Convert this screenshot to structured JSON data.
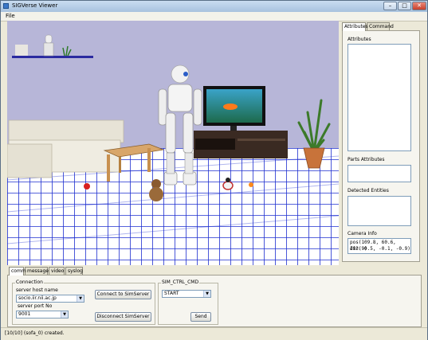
{
  "window": {
    "title": "SIGVerse Viewer",
    "buttons": {
      "minimize": "–",
      "maximize": "□",
      "close": "✕"
    }
  },
  "menu": {
    "file": "File"
  },
  "side_panel": {
    "tabs": [
      {
        "label": "Attributes"
      },
      {
        "label": "Command"
      }
    ],
    "attributes_label": "Attributes",
    "parts_attributes_label": "Parts Attributes",
    "detected_entities_label": "Detected Entities",
    "camera_info_label": "Camera Info",
    "camera_pos": "pos(109.8, 60.6, 203.9)",
    "camera_dir": "dir(-0.5, -0.1, -0.9)"
  },
  "bottom_panel": {
    "tabs": [
      {
        "label": "comm"
      },
      {
        "label": "messages"
      },
      {
        "label": "video"
      },
      {
        "label": "syslog"
      }
    ],
    "connection_label": "Connection",
    "server_host_label": "server host name",
    "server_host_value": "socio.iir.nii.ac.jp",
    "server_port_label": "server port No",
    "server_port_value": "9001",
    "connect_button": "Connect to SimServer",
    "disconnect_button": "Disconnect SimServer",
    "sim_ctrl_label": "SIM_CTRL_CMD",
    "sim_ctrl_value": "START",
    "send_button": "Send"
  },
  "status_bar": {
    "text": "[10/10] (sofa_0) created."
  },
  "colors": {
    "floor_grid": "#1e2fd0",
    "wall": "#b7b6d8",
    "robot_accent": "#2c5ec8"
  }
}
